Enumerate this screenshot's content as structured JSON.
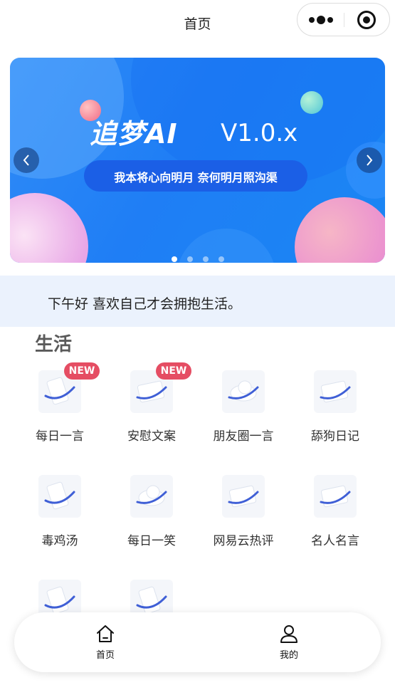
{
  "navbar": {
    "title": "首页",
    "menu_icon": "more-dots-icon",
    "close_icon": "record-close-icon"
  },
  "banner": {
    "title": "追梦AI",
    "version": "V1.0.x",
    "subtitle": "我本将心向明月 奈何明月照沟渠",
    "prev_icon": "chevron-left-icon",
    "next_icon": "chevron-right-icon",
    "slide_count": 4,
    "active_slide": 1,
    "colors": {
      "background": "#1f7ef5",
      "pill": "#1b5fe6"
    }
  },
  "notice": {
    "text": "下午好 喜欢自己才会拥抱生活。"
  },
  "section": {
    "title": "生活"
  },
  "items": [
    {
      "label": "每日一言",
      "badge": "NEW",
      "icon": "phone-ring-icon"
    },
    {
      "label": "安慰文案",
      "badge": "NEW",
      "icon": "card-ring-icon"
    },
    {
      "label": "朋友圈一言",
      "badge": "",
      "icon": "cloud-ring-icon"
    },
    {
      "label": "舔狗日记",
      "badge": "",
      "icon": "card-ring-icon"
    },
    {
      "label": "毒鸡汤",
      "badge": "",
      "icon": "phone-ring-icon"
    },
    {
      "label": "每日一笑",
      "badge": "",
      "icon": "cloud-ring-icon"
    },
    {
      "label": "网易云热评",
      "badge": "",
      "icon": "card-ring-icon"
    },
    {
      "label": "名人名言",
      "badge": "",
      "icon": "card-ring-icon"
    },
    {
      "label": "",
      "badge": "",
      "icon": "phone-ring-icon"
    },
    {
      "label": "",
      "badge": "",
      "icon": "phone-ring-icon"
    }
  ],
  "tabbar": {
    "home": {
      "label": "首页",
      "icon": "home-icon"
    },
    "me": {
      "label": "我的",
      "icon": "user-icon"
    }
  }
}
